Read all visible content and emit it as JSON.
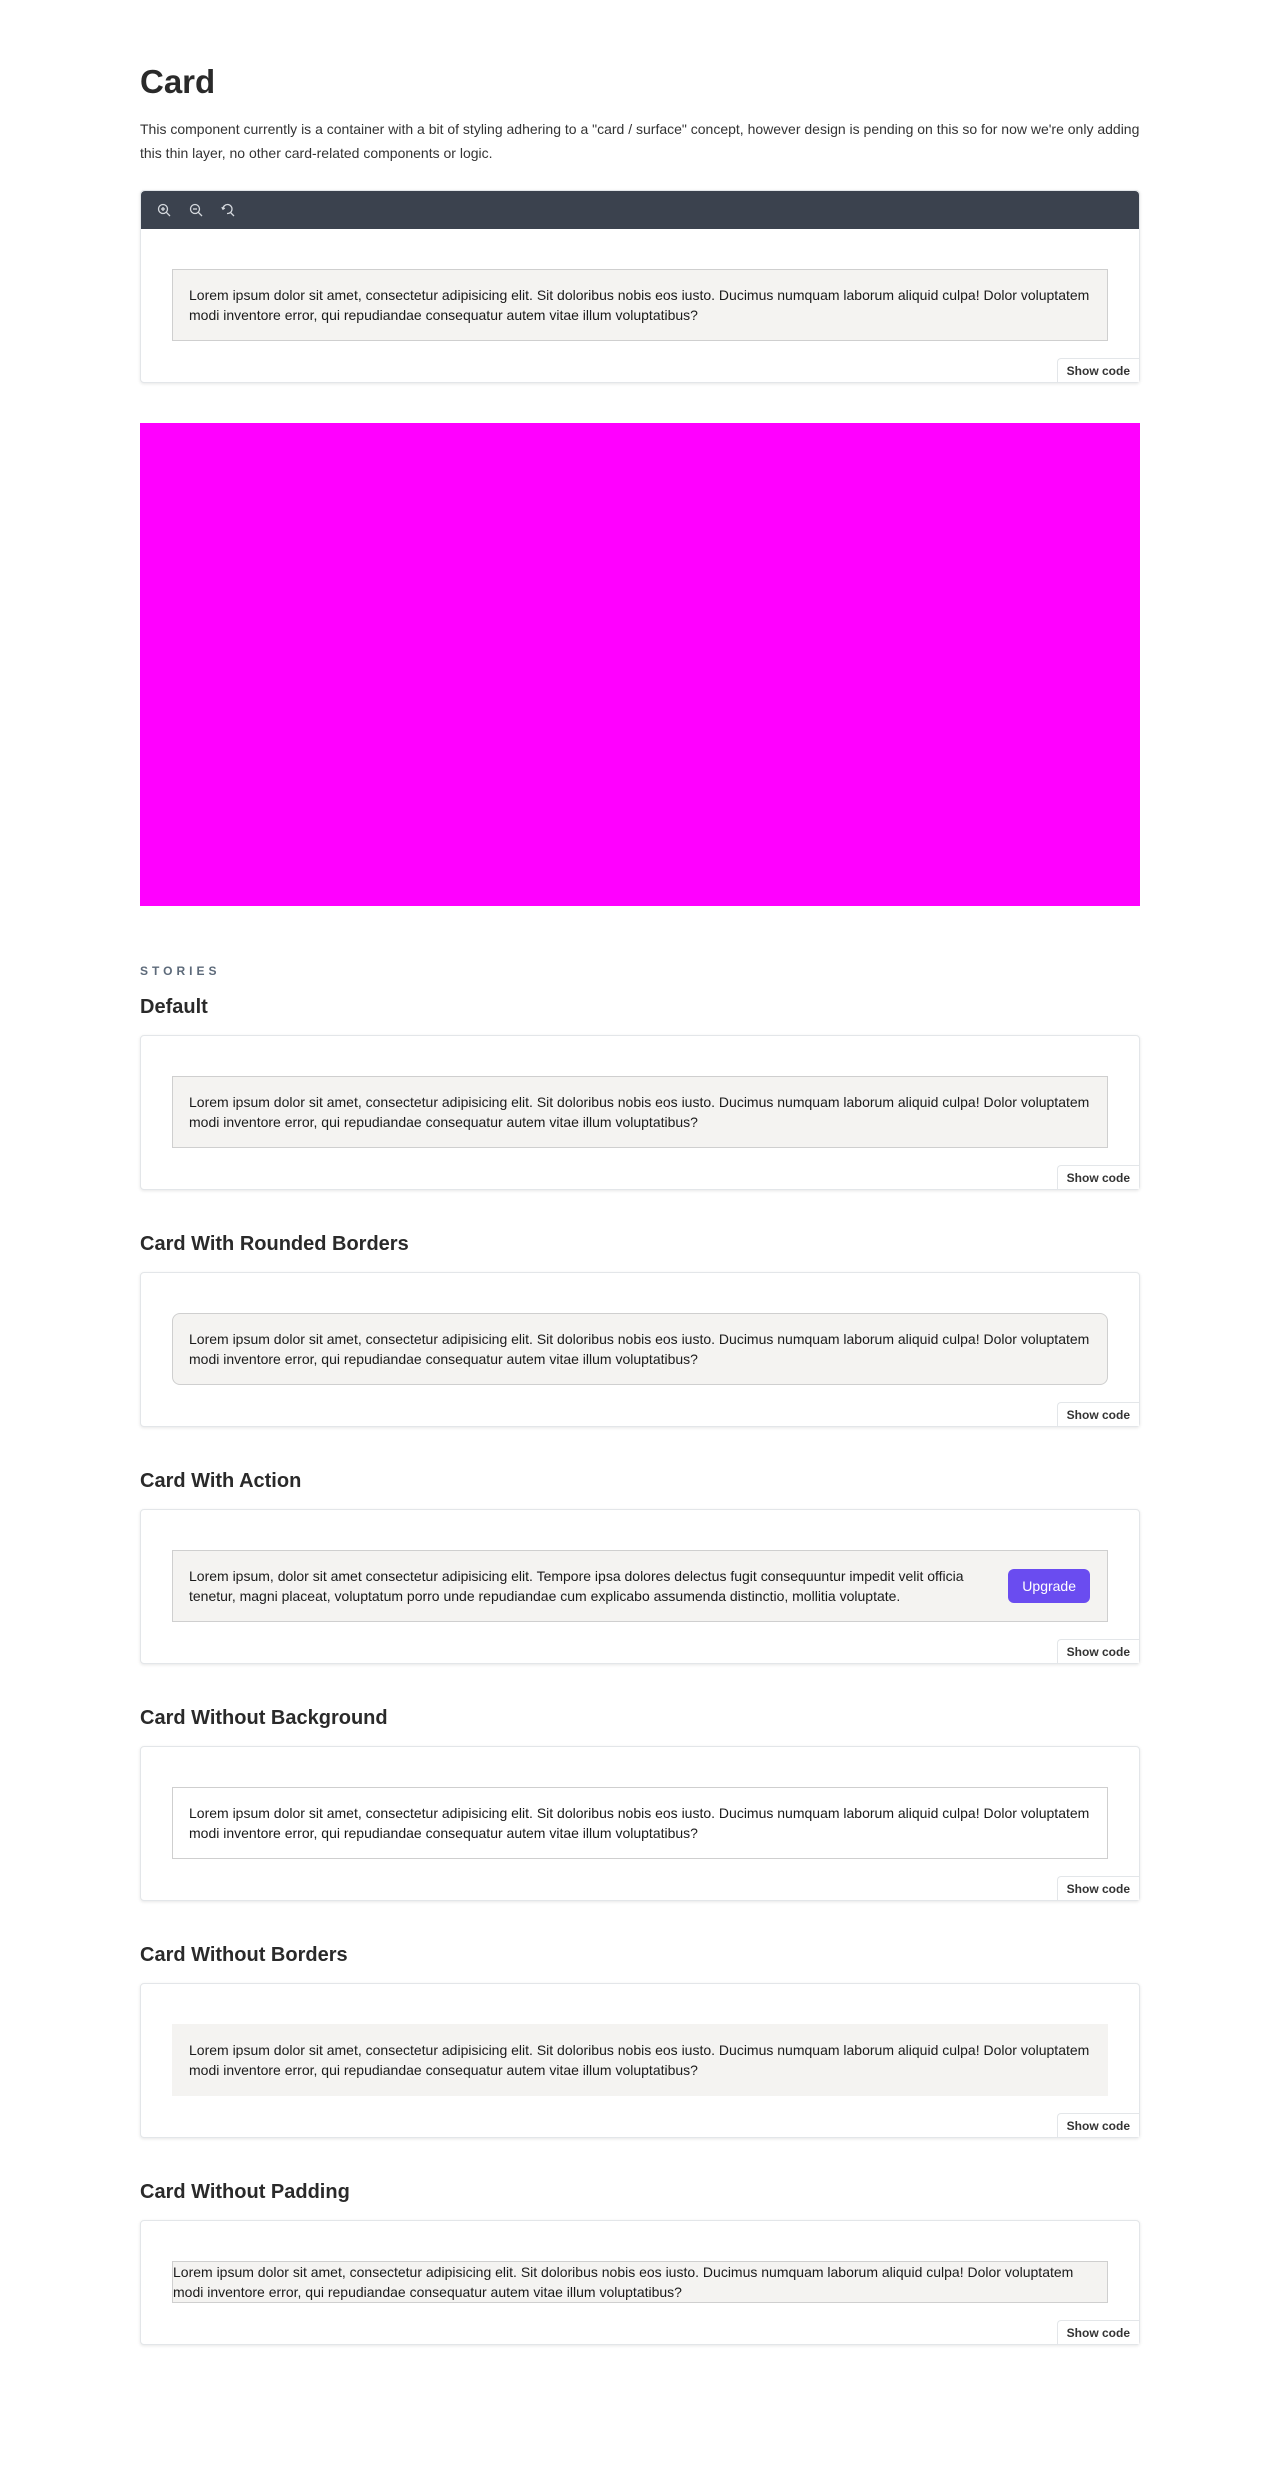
{
  "page": {
    "title": "Card",
    "description": "This component currently is a container with a bit of styling adhering to a \"card / surface\" concept, however design is pending on this so for now we're only adding this thin layer, no other card-related components or logic."
  },
  "toolbar": {
    "zoom_in_icon": "zoom-in-icon",
    "zoom_out_icon": "zoom-out-icon",
    "reset_zoom_icon": "reset-zoom-icon"
  },
  "colors": {
    "toolbar_bg": "#3b424e",
    "card_bg": "#f4f3f1",
    "magenta_block": "#ff00ff",
    "upgrade_button": "#6a4cf0"
  },
  "lorem": "Lorem ipsum dolor sit amet, consectetur adipisicing elit. Sit doloribus nobis eos iusto. Ducimus numquam laborum aliquid culpa! Dolor voluptatem modi inventore error, qui repudiandae consequatur autem vitae illum voluptatibus?",
  "show_code_label": "Show code",
  "stories_label": "STORIES",
  "stories": [
    {
      "title": "Default",
      "text": "Lorem ipsum dolor sit amet, consectetur adipisicing elit. Sit doloribus nobis eos iusto. Ducimus numquam laborum aliquid culpa! Dolor voluptatem modi inventore error, qui repudiandae consequatur autem vitae illum voluptatibus?"
    },
    {
      "title": "Card With Rounded Borders",
      "text": "Lorem ipsum dolor sit amet, consectetur adipisicing elit. Sit doloribus nobis eos iusto. Ducimus numquam laborum aliquid culpa! Dolor voluptatem modi inventore error, qui repudiandae consequatur autem vitae illum voluptatibus?"
    },
    {
      "title": "Card With Action",
      "text": "Lorem ipsum, dolor sit amet consectetur adipisicing elit. Tempore ipsa dolores delectus fugit consequuntur impedit velit officia tenetur, magni placeat, voluptatum porro unde repudiandae cum explicabo assumenda distinctio, mollitia voluptate.",
      "action_label": "Upgrade"
    },
    {
      "title": "Card Without Background",
      "text": "Lorem ipsum dolor sit amet, consectetur adipisicing elit. Sit doloribus nobis eos iusto. Ducimus numquam laborum aliquid culpa! Dolor voluptatem modi inventore error, qui repudiandae consequatur autem vitae illum voluptatibus?"
    },
    {
      "title": "Card Without Borders",
      "text": "Lorem ipsum dolor sit amet, consectetur adipisicing elit. Sit doloribus nobis eos iusto. Ducimus numquam laborum aliquid culpa! Dolor voluptatem modi inventore error, qui repudiandae consequatur autem vitae illum voluptatibus?"
    },
    {
      "title": "Card Without Padding",
      "text": "Lorem ipsum dolor sit amet, consectetur adipisicing elit. Sit doloribus nobis eos iusto. Ducimus numquam laborum aliquid culpa! Dolor voluptatem modi inventore error, qui repudiandae consequatur autem vitae illum voluptatibus?"
    }
  ]
}
